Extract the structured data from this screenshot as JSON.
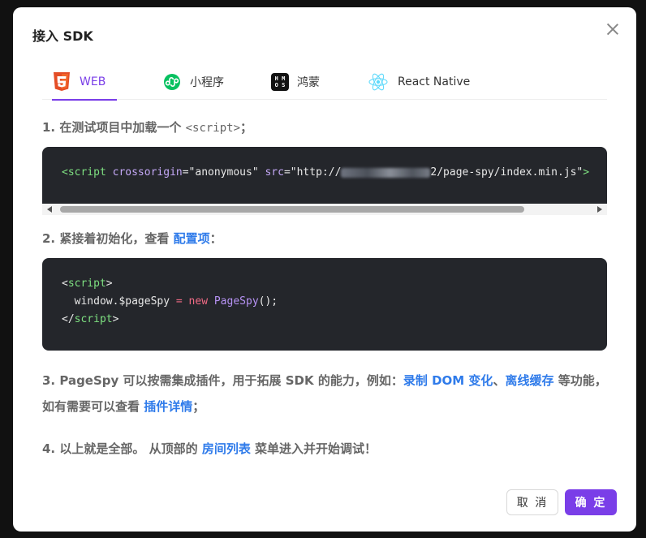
{
  "modal": {
    "title": "接入 SDK"
  },
  "tabs": [
    {
      "label": "WEB",
      "icon": "html5-icon",
      "active": true
    },
    {
      "label": "小程序",
      "icon": "miniprogram-icon",
      "active": false
    },
    {
      "label": "鸿蒙",
      "icon": "harmonyos-icon",
      "active": false
    },
    {
      "label": "React Native",
      "icon": "react-icon",
      "active": false
    }
  ],
  "harmony_logo_letters": {
    "top": "H M",
    "bottom": "O S"
  },
  "step1": {
    "text": "1. 在测试项目中加载一个 ",
    "code": "<script>",
    "suffix": "；"
  },
  "code1": {
    "open": "<script",
    "attr1": "crossorigin",
    "eq1": "=",
    "val1": "\"anonymous\"",
    "attr2": "src",
    "eq2": "=",
    "val2_start": "\"http://",
    "val2_end": "2/page-spy/index.min.js\"",
    "close": ">"
  },
  "step2": {
    "text": "2. 紧接着初始化，查看 ",
    "link": "配置项",
    "suffix": "："
  },
  "code2": {
    "l1_open": "<",
    "l1_tag": "script",
    "l1_close": ">",
    "l2_var": "  window.$pageSpy",
    "l2_eq": " = ",
    "l2_new": "new",
    "l2_space": " ",
    "l2_fn": "PageSpy",
    "l2_end": "();",
    "l3_open": "</",
    "l3_tag": "script",
    "l3_close": ">"
  },
  "step3": {
    "text": "3. PageSpy 可以按需集成插件，用于拓展 SDK 的能力，例如：",
    "link1": "录制 DOM 变化",
    "sep": "、",
    "link2": "离线缓存",
    "mid": " 等功能，如有需要可以查看 ",
    "link3": "插件详情",
    "suffix": "；"
  },
  "step4": {
    "text": "4. 以上就是全部。 从顶部的 ",
    "link": "房间列表",
    "suffix": " 菜单进入并开始调试！"
  },
  "buttons": {
    "cancel": "取 消",
    "ok": "确 定"
  },
  "colors": {
    "accent": "#7a3ee8",
    "link": "#2f7bea",
    "code_bg": "#24262b"
  }
}
